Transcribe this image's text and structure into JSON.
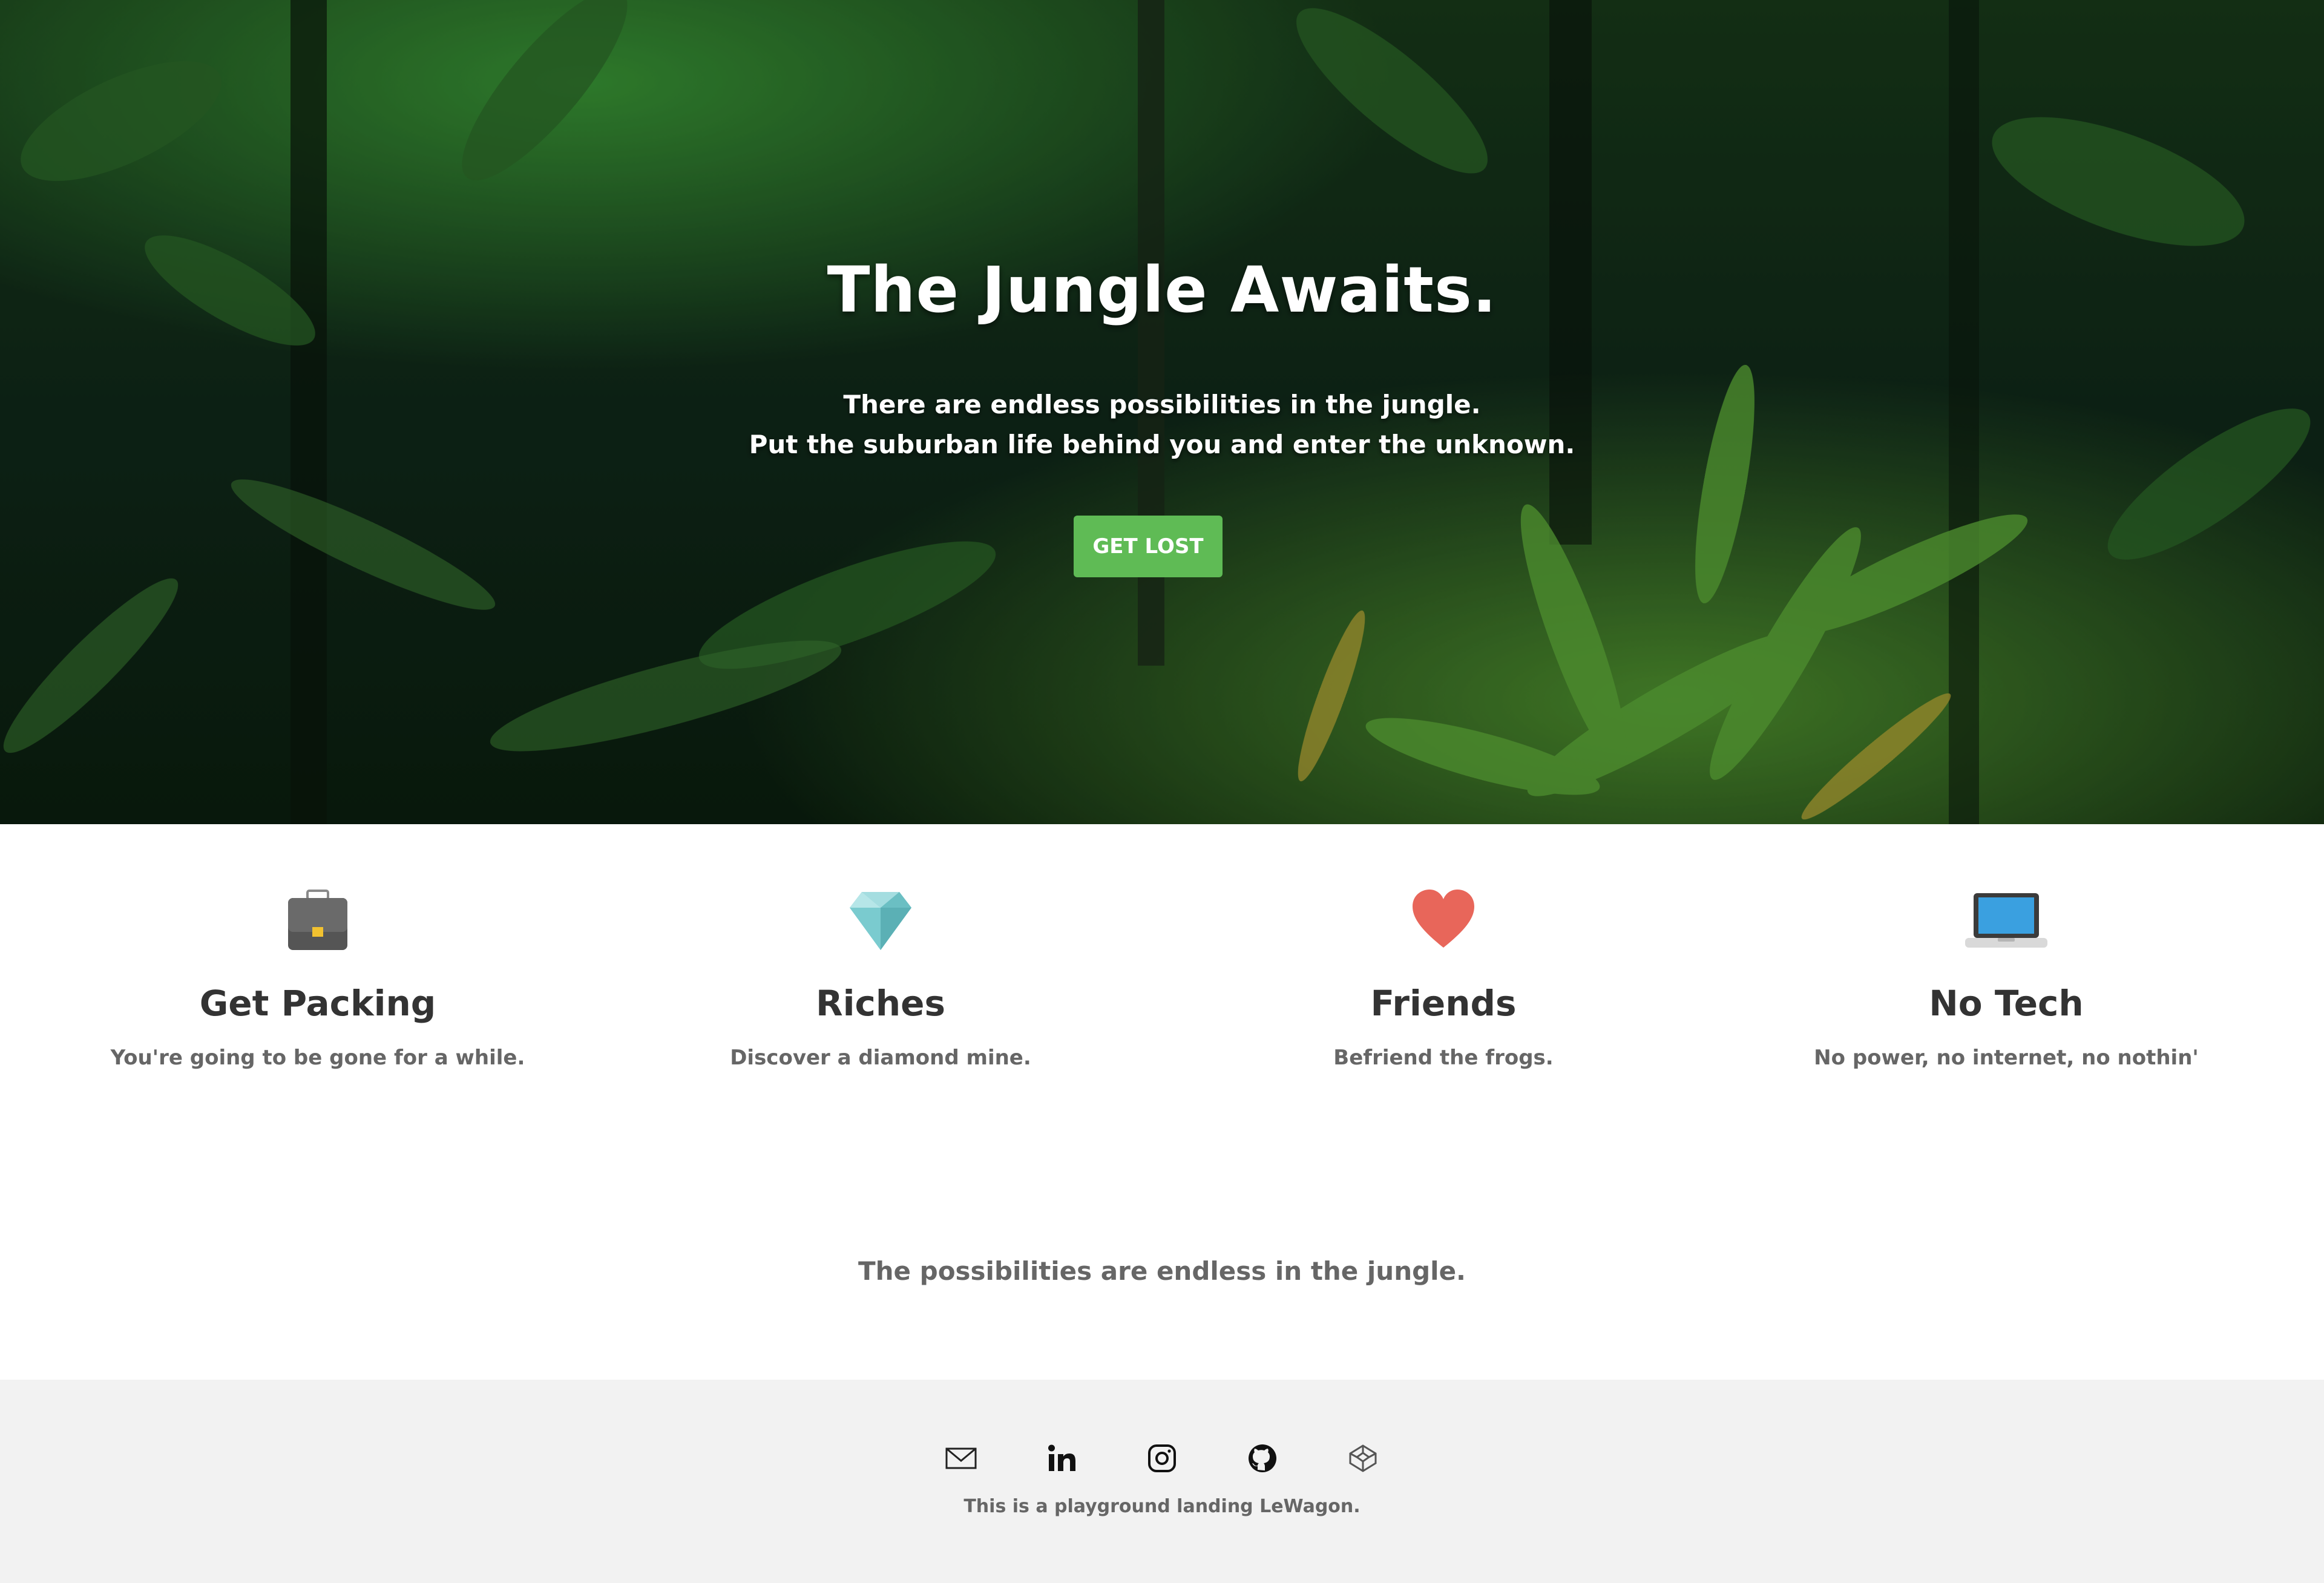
{
  "hero": {
    "title": "The Jungle Awaits.",
    "subtitle_line1": "There are endless possibilities in the jungle.",
    "subtitle_line2": "Put the suburban life behind you and enter the unknown.",
    "cta_label": "GET LOST",
    "cta_color": "#5fbb55"
  },
  "features": [
    {
      "icon": "briefcase-icon",
      "title": "Get Packing",
      "description": "You're going to be gone for a while."
    },
    {
      "icon": "diamond-icon",
      "title": "Riches",
      "description": "Discover a diamond mine."
    },
    {
      "icon": "heart-icon",
      "title": "Friends",
      "description": "Befriend the frogs."
    },
    {
      "icon": "laptop-icon",
      "title": "No Tech",
      "description": "No power, no internet, no nothin'"
    }
  ],
  "tagline": "The possibilities are endless in the jungle.",
  "footer": {
    "social_icons": [
      "mail-icon",
      "linkedin-icon",
      "instagram-icon",
      "github-icon",
      "codepen-icon"
    ],
    "text": "This is a playground landing LeWagon."
  }
}
